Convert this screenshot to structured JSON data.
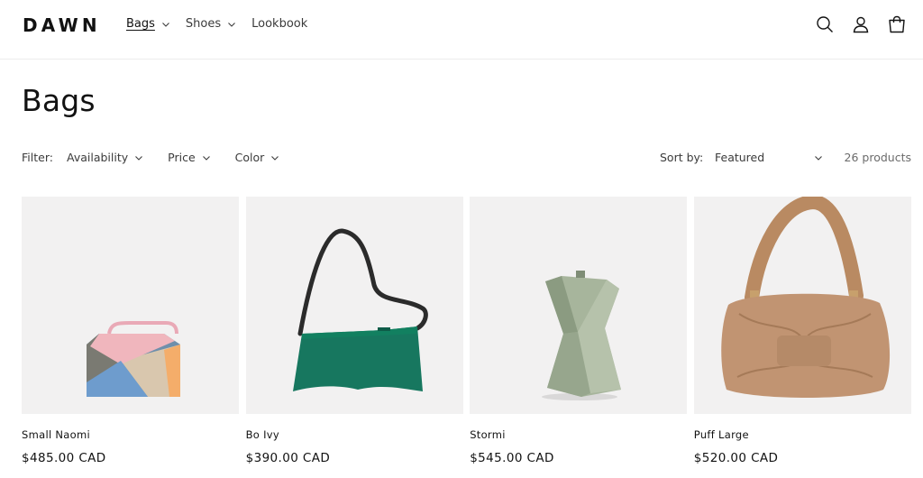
{
  "header": {
    "logo": "DAWN",
    "nav": [
      {
        "label": "Bags"
      },
      {
        "label": "Shoes"
      },
      {
        "label": "Lookbook"
      }
    ],
    "icons": [
      "search-icon",
      "account-icon",
      "cart-icon"
    ]
  },
  "page": {
    "title": "Bags"
  },
  "filter": {
    "label": "Filter:",
    "items": [
      {
        "label": "Availability"
      },
      {
        "label": "Price"
      },
      {
        "label": "Color"
      }
    ],
    "sort_label": "Sort by:",
    "sort_value": "Featured",
    "count": "26 products"
  },
  "products": [
    {
      "name": "Small Naomi",
      "price": "$485.00 CAD"
    },
    {
      "name": "Bo Ivy",
      "price": "$390.00 CAD"
    },
    {
      "name": "Stormi",
      "price": "$545.00 CAD"
    },
    {
      "name": "Puff Large",
      "price": "$520.00 CAD"
    }
  ],
  "colors": {
    "text": "#121212",
    "muted": "#3b3b3b",
    "image_bg": "#f2f1f1",
    "border": "#ececec"
  }
}
